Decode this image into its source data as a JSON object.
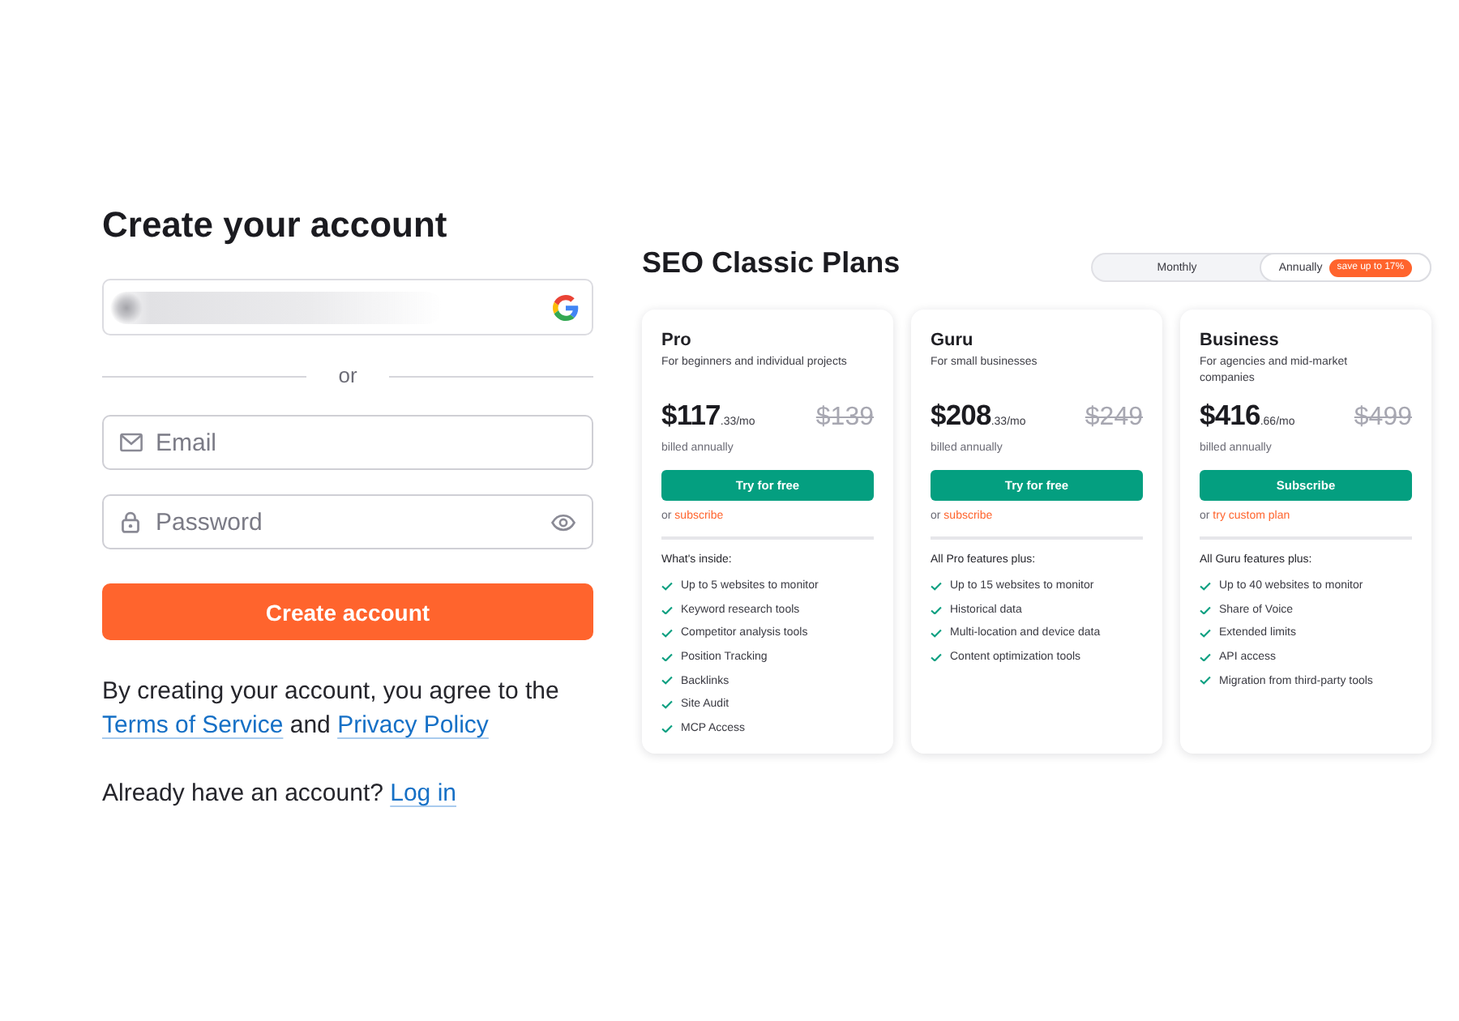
{
  "signup": {
    "title": "Create your account",
    "divider_text": "or",
    "email_field": {
      "placeholder": "Email"
    },
    "password_field": {
      "placeholder": "Password"
    },
    "submit_button": "Create account",
    "agreement": {
      "text": "By creating your account, you agree to the",
      "terms_link": "Terms of Service",
      "joiner": "and",
      "privacy_link": "Privacy Policy"
    },
    "login_prompt": {
      "text": "Already have an account?",
      "link": "Log in"
    }
  },
  "plans_panel": {
    "title": "SEO Classic Plans",
    "billing_toggle": [
      {
        "label": "Monthly",
        "selected": false
      },
      {
        "label": "Annually",
        "selected": true,
        "badge": "save up to 17%"
      }
    ],
    "plans": [
      {
        "name": "Pro",
        "description": "For beginners and individual projects",
        "price": "$117",
        "price_fraction": ".33/mo",
        "old_price": "$139",
        "billing_note": "billed annually",
        "button": "Try for free",
        "alt_prefix": "or",
        "alt_link": "subscribe",
        "features_heading": "What's inside:",
        "features": [
          "Up to 5 websites to monitor",
          "Keyword research tools",
          "Competitor analysis tools",
          "Position Tracking",
          "Backlinks",
          "Site Audit",
          "MCP Access"
        ]
      },
      {
        "name": "Guru",
        "description": "For small businesses",
        "price": "$208",
        "price_fraction": ".33/mo",
        "old_price": "$249",
        "billing_note": "billed annually",
        "button": "Try for free",
        "alt_prefix": "or",
        "alt_link": "subscribe",
        "features_heading": "All Pro features plus:",
        "features": [
          "Up to 15 websites to monitor",
          "Historical data",
          "Multi-location and device data",
          "Content optimization tools"
        ]
      },
      {
        "name": "Business",
        "description": "For agencies and mid-market companies",
        "price": "$416",
        "price_fraction": ".66/mo",
        "old_price": "$499",
        "billing_note": "billed annually",
        "button": "Subscribe",
        "alt_prefix": "or",
        "alt_link": "try custom plan",
        "features_heading": "All Guru features plus:",
        "features": [
          "Up to 40 websites to monitor",
          "Share of Voice",
          "Extended limits",
          "API access",
          "Migration from third-party tools"
        ]
      }
    ]
  }
}
